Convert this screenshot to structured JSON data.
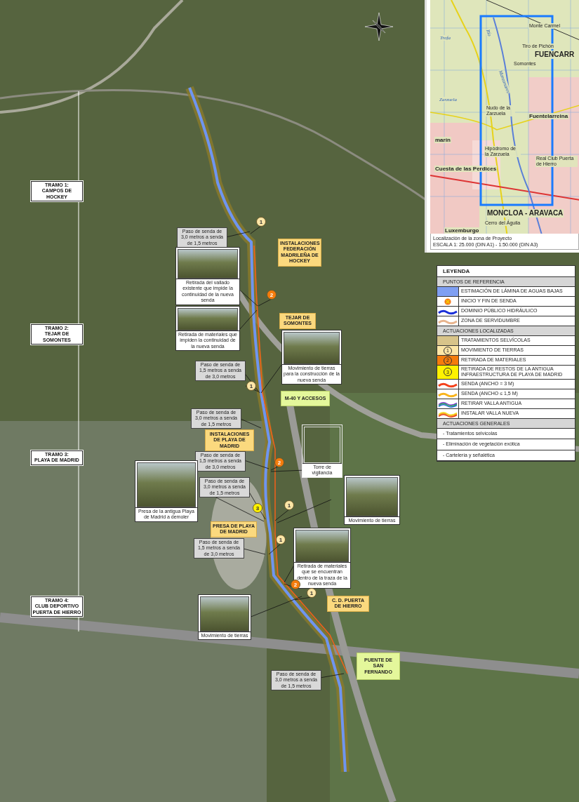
{
  "inset_map": {
    "labels": [
      {
        "text": "Monte Carmel",
        "kind": "place"
      },
      {
        "text": "Tiro de Pichón",
        "kind": "place"
      },
      {
        "text": "Somontes",
        "kind": "place"
      },
      {
        "text": "FUENCARR",
        "kind": "district"
      },
      {
        "text": "Río",
        "kind": "river"
      },
      {
        "text": "Manzanares",
        "kind": "river"
      },
      {
        "text": "Trofa",
        "kind": "river"
      },
      {
        "text": "Zarzuela",
        "kind": "river"
      },
      {
        "text": "Nudo de la Zarzuela",
        "kind": "place"
      },
      {
        "text": "Fuentelarreina",
        "kind": "town"
      },
      {
        "text": "marín",
        "kind": "town"
      },
      {
        "text": "Cuesta de las Perdices",
        "kind": "town"
      },
      {
        "text": "Hipódromo de la Zarzuela",
        "kind": "place"
      },
      {
        "text": "Real Club Puerta de Hierro",
        "kind": "place"
      },
      {
        "text": "MONCLOA - ARAVACA",
        "kind": "district"
      },
      {
        "text": "Cerro del Águila",
        "kind": "place"
      },
      {
        "text": "Luxemburgo",
        "kind": "town"
      }
    ],
    "caption": [
      "Localización de la zona de Proyecto",
      "ESCALA 1: 25.000 (DIN A1) - 1:50.000 (DIN A3)"
    ]
  },
  "legend": {
    "title": "LEYENDA",
    "sections": [
      {
        "title": "PUNTOS DE REFERENCIA",
        "items": [
          {
            "kind": "fill",
            "color": "#7f9ff2",
            "text": "ESTIMACIÓN DE LÁMINA DE AGUAS BAJAS"
          },
          {
            "kind": "start_end",
            "text": "INICIO Y FIN DE SENDA"
          },
          {
            "kind": "line",
            "color": "#1a2fd8",
            "text": "DOMINIO PÚBLICO HIDRÁULICO"
          },
          {
            "kind": "line",
            "color": "#e8b48e",
            "text": "ZONA DE SERVIDUMBRE"
          }
        ]
      },
      {
        "title": "ACTUACIONES LOCALIZADAS",
        "items": [
          {
            "kind": "fill",
            "color": "#d8c48a",
            "text": "TRATAMIENTOS SELVÍCOLAS"
          },
          {
            "kind": "marker",
            "color": "#fde6a6",
            "number": "1",
            "text": "MOVIMIENTO DE TIERRAS"
          },
          {
            "kind": "marker",
            "color": "#f57c0c",
            "number": "2",
            "text": "RETIRADA DE MATERIALES"
          },
          {
            "kind": "marker",
            "color": "#fff200",
            "number": "3",
            "text": "RETIRADA DE RESTOS DE LA ANTIGUA INFRAESTRUCTURA DE PLAYA DE MADRID"
          },
          {
            "kind": "line",
            "color": "#f4401a",
            "text": "SENDA (ANCHO = 3 M)"
          },
          {
            "kind": "line",
            "color": "#f9b41c",
            "text": "SENDA (ANCHO ≤ 1,5 M)"
          },
          {
            "kind": "old_fence",
            "text": "RETIRAR VALLA ANTIGUA"
          },
          {
            "kind": "new_fence",
            "text": "INSTALAR VALLA NUEVA"
          }
        ]
      },
      {
        "title": "ACTUACIONES GENERALES",
        "items": [
          {
            "kind": "text",
            "text": "- Tratamientos selvícolas"
          },
          {
            "kind": "text",
            "text": "- Eliminación de vegetación exótica"
          },
          {
            "kind": "text",
            "text": "- Cartelería y señalética"
          }
        ]
      }
    ]
  },
  "tramos": [
    {
      "lines": [
        "TRAMO 1:",
        "CAMPOS DE HOCKEY"
      ]
    },
    {
      "lines": [
        "TRAMO 2:",
        "TEJAR DE SOMONTES"
      ]
    },
    {
      "lines": [
        "TRAMO 3:",
        "PLAYA DE MADRID"
      ]
    },
    {
      "lines": [
        "TRAMO 4:",
        "CLUB DEPORTIVO",
        "PUERTA DE HIERRO"
      ]
    }
  ],
  "places": [
    {
      "kind": "facility",
      "text": "INSTALACIONES FEDERACIÓN MADRILEÑA DE HOCKEY"
    },
    {
      "kind": "facility",
      "text": "TEJAR DE SOMONTES"
    },
    {
      "kind": "road",
      "text": "M-40 Y ACCESOS"
    },
    {
      "kind": "facility",
      "text": "INSTALACIONES DE PLAYA DE MADRID"
    },
    {
      "kind": "facility",
      "text": "PRESA DE PLAYA DE MADRID"
    },
    {
      "kind": "facility",
      "text": "C. D. PUERTA DE HIERRO"
    },
    {
      "kind": "road",
      "text": "PUENTE DE SAN FERNANDO"
    }
  ],
  "path_notes": [
    {
      "text": "Paso de senda de 3,0 metros a senda de 1,5 metros"
    },
    {
      "text": "Paso de senda de 1,5 metros a senda de 3,0 metros"
    },
    {
      "text": "Paso de senda de 3,0 metros a senda de 1,5 metros"
    },
    {
      "text": "Paso de senda de 1,5 metros a senda de 3,0 metros"
    },
    {
      "text": "Paso de senda de 3,0 metros a senda de 1,5 metros"
    },
    {
      "text": "Paso de senda de 1,5 metros a senda de 3,0 metros"
    },
    {
      "text": "Paso de senda de 3,0 metros a senda de 1,5 metros"
    }
  ],
  "photos": [
    {
      "kind": "photo",
      "caption": "Retirada del vallado existente que impide la continuidad de la nueva senda"
    },
    {
      "kind": "photo",
      "caption": "Retirada de materiales que impiden la continuidad de la nueva senda"
    },
    {
      "kind": "photo",
      "caption": "Movimiento de tierras para la construcción de la nueva senda"
    },
    {
      "kind": "photo",
      "caption": "Presa de la antigua Playa de Madrid a demoler"
    },
    {
      "kind": "frame",
      "caption": "Torre de vigilancia"
    },
    {
      "kind": "photo",
      "caption": "Movimiento de tierras"
    },
    {
      "kind": "photo",
      "caption": "Retirada de materiales que se encuentran dentro de la traza de la nueva senda"
    },
    {
      "kind": "photo",
      "caption": "Movimiento de tierras"
    }
  ],
  "markers": [
    {
      "number": "1",
      "color": "#fde6a6"
    },
    {
      "number": "2",
      "color": "#f57c0c"
    },
    {
      "number": "1",
      "color": "#fde6a6"
    },
    {
      "number": "2",
      "color": "#f57c0c"
    },
    {
      "number": "3",
      "color": "#fff200"
    },
    {
      "number": "1",
      "color": "#fde6a6"
    },
    {
      "number": "1",
      "color": "#fde6a6"
    },
    {
      "number": "2",
      "color": "#f57c0c"
    },
    {
      "number": "1",
      "color": "#fde6a6"
    }
  ]
}
